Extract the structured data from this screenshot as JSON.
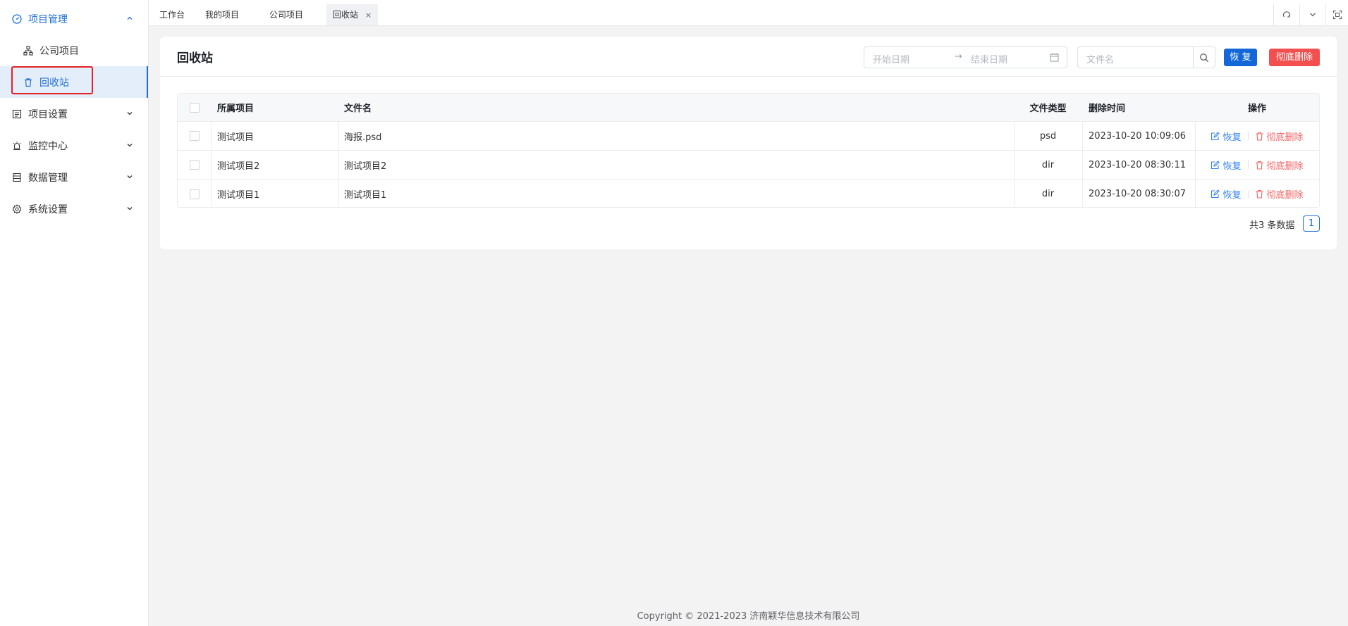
{
  "sidebar": {
    "items": [
      {
        "label": "项目管理",
        "icon": "dashboard-icon"
      },
      {
        "label": "公司项目",
        "icon": "org-chart-icon"
      },
      {
        "label": "回收站",
        "icon": "trash-icon"
      },
      {
        "label": "项目设置",
        "icon": "list-icon"
      },
      {
        "label": "监控中心",
        "icon": "alarm-icon"
      },
      {
        "label": "数据管理",
        "icon": "database-icon"
      },
      {
        "label": "系统设置",
        "icon": "gear-icon"
      }
    ]
  },
  "tabs": [
    {
      "label": "工作台"
    },
    {
      "label": "我的项目"
    },
    {
      "label": "公司项目"
    },
    {
      "label": "回收站",
      "close": "×"
    }
  ],
  "card": {
    "title": "回收站",
    "date_range": {
      "start_placeholder": "开始日期",
      "separator": "→",
      "end_placeholder": "结束日期"
    },
    "search": {
      "placeholder": "文件名"
    },
    "restore_button": "恢 复",
    "purge_button": "彻底删除"
  },
  "table": {
    "headers": {
      "project": "所属项目",
      "filename": "文件名",
      "filetype": "文件类型",
      "deleted_at": "删除时间",
      "actions": "操作"
    },
    "rows": [
      {
        "project": "测试项目",
        "filename": "海报.psd",
        "filetype": "psd",
        "deleted_at": "2023-10-20 10:09:06",
        "restore": "恢复",
        "purge": "彻底删除"
      },
      {
        "project": "测试项目2",
        "filename": "测试项目2",
        "filetype": "dir",
        "deleted_at": "2023-10-20 08:30:11",
        "restore": "恢复",
        "purge": "彻底删除"
      },
      {
        "project": "测试项目1",
        "filename": "测试项目1",
        "filetype": "dir",
        "deleted_at": "2023-10-20 08:30:07",
        "restore": "恢复",
        "purge": "彻底删除"
      }
    ]
  },
  "pagination": {
    "total": "共3 条数据",
    "current_page": "1"
  },
  "footer": {
    "copyright": "Copyright © 2021-2023 济南颖华信息技术有限公司"
  },
  "colors": {
    "primary": "#1f6fd6",
    "danger": "#f44f4f",
    "highlight": "#e02424"
  }
}
